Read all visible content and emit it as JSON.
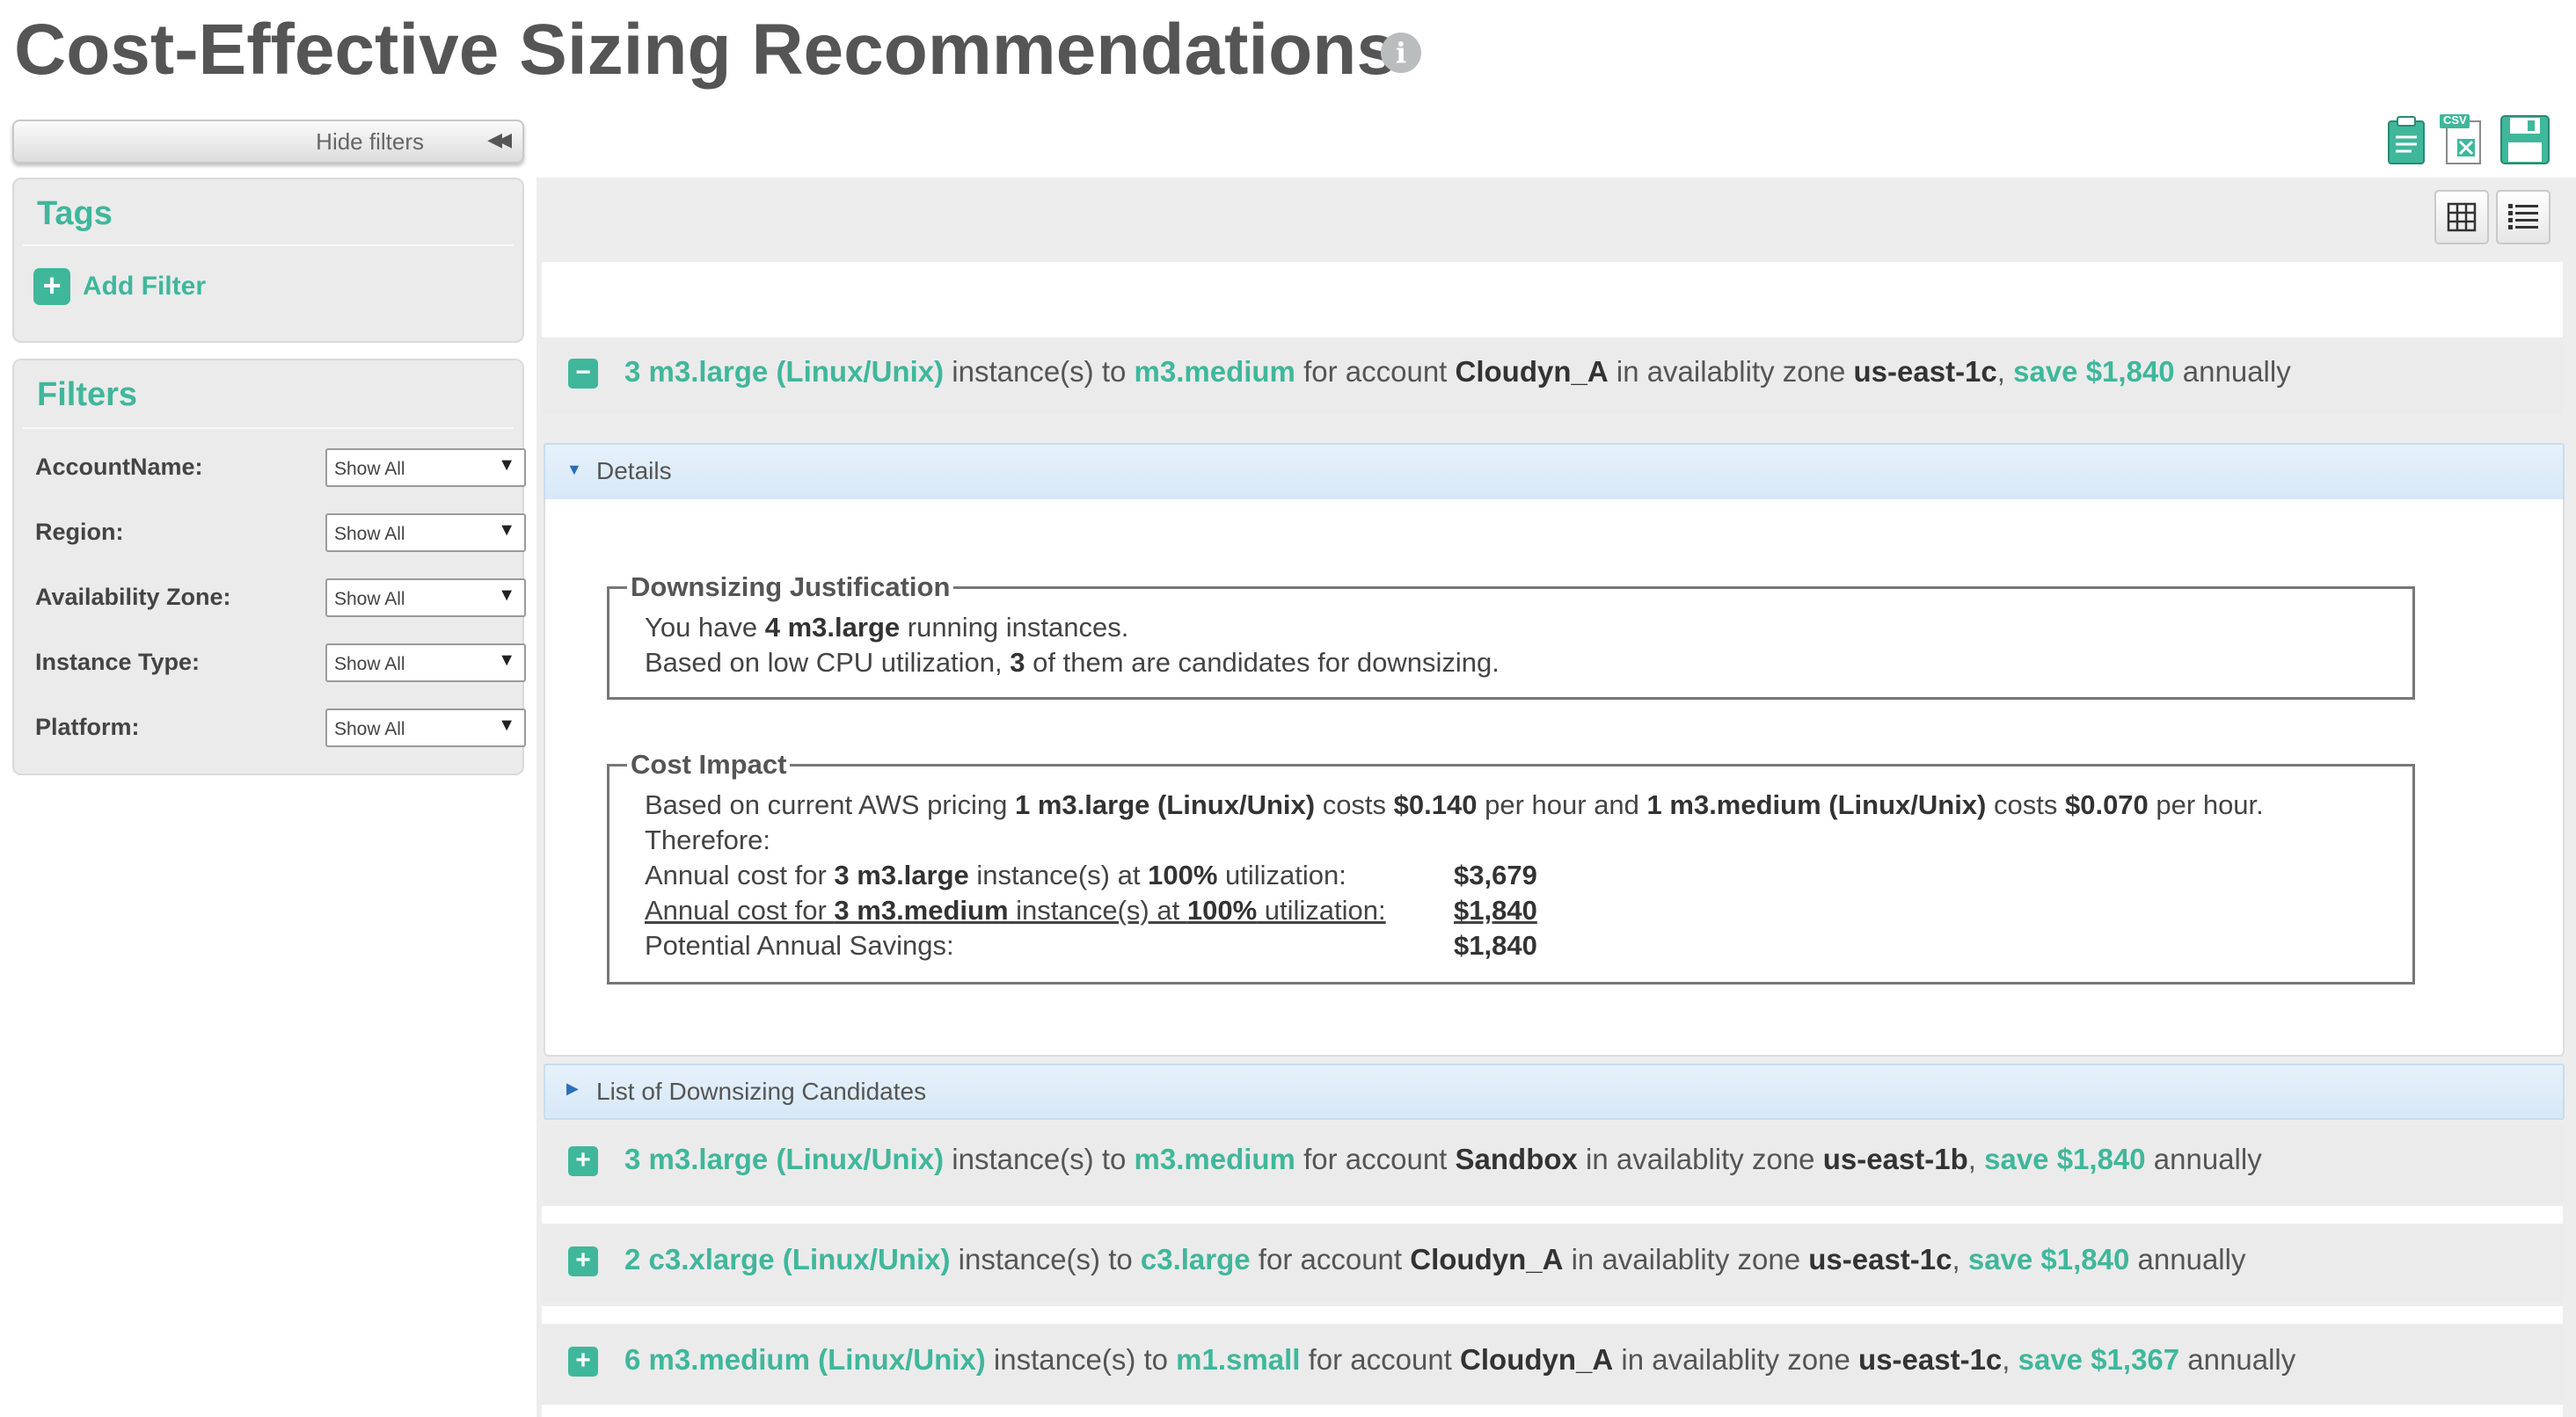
{
  "header": {
    "title": "Cost-Effective Sizing Recommendations",
    "info_glyph": "i"
  },
  "sidebar": {
    "hide_filters_label": "Hide filters",
    "hide_filters_arrow": "◀◀",
    "tags": {
      "title": "Tags",
      "add_filter_label": "Add Filter"
    },
    "filters": {
      "title": "Filters",
      "items": [
        {
          "label": "AccountName:",
          "value": "Show All"
        },
        {
          "label": "Region:",
          "value": "Show All"
        },
        {
          "label": "Availability Zone:",
          "value": "Show All"
        },
        {
          "label": "Instance Type:",
          "value": "Show All"
        },
        {
          "label": "Platform:",
          "value": "Show All"
        }
      ]
    }
  },
  "toolbar": {
    "export_icons": [
      "clipboard-icon",
      "csv-export-icon",
      "save-icon"
    ],
    "csv_badge": "CSV",
    "view_icons": [
      "grid-view-icon",
      "list-view-icon"
    ]
  },
  "recommendations": [
    {
      "toggle": "−",
      "expanded": true,
      "count": "3",
      "from_type": "m3.large (Linux/Unix)",
      "mid1": " instance(s) to ",
      "to_type": "m3.medium",
      "mid2": " for account ",
      "account": "Cloudyn_A",
      "mid3": " in availablity zone ",
      "zone": "us-east-1c",
      "sep": ", ",
      "save": "save $1,840",
      "tail": " annually"
    },
    {
      "toggle": "+",
      "expanded": false,
      "count": "3",
      "from_type": "m3.large (Linux/Unix)",
      "mid1": " instance(s) to ",
      "to_type": "m3.medium",
      "mid2": " for account ",
      "account": "Sandbox",
      "mid3": " in availablity zone ",
      "zone": "us-east-1b",
      "sep": ", ",
      "save": "save $1,840",
      "tail": " annually"
    },
    {
      "toggle": "+",
      "expanded": false,
      "count": "2",
      "from_type": "c3.xlarge (Linux/Unix)",
      "mid1": " instance(s) to ",
      "to_type": "c3.large",
      "mid2": " for account ",
      "account": "Cloudyn_A",
      "mid3": " in availablity zone ",
      "zone": "us-east-1c",
      "sep": ", ",
      "save": "save $1,840",
      "tail": " annually"
    },
    {
      "toggle": "+",
      "expanded": false,
      "count": "6",
      "from_type": "m3.medium (Linux/Unix)",
      "mid1": " instance(s) to ",
      "to_type": "m1.small",
      "mid2": " for account ",
      "account": "Cloudyn_A",
      "mid3": " in availablity zone ",
      "zone": "us-east-1c",
      "sep": ", ",
      "save": "save $1,367",
      "tail": " annually"
    }
  ],
  "details": {
    "header": "Details",
    "justification": {
      "legend": "Downsizing Justification",
      "l1_a": "You have ",
      "l1_b": "4 m3.large",
      "l1_c": " running instances.",
      "l2_a": "Based on low CPU utilization, ",
      "l2_b": "3",
      "l2_c": " of them are candidates for downsizing."
    },
    "cost_impact": {
      "legend": "Cost Impact",
      "p_a": "Based on current AWS pricing ",
      "p_b": "1 m3.large (Linux/Unix)",
      "p_c": " costs ",
      "p_d": "$0.140",
      "p_e": " per hour and ",
      "p_f": "1 m3.medium (Linux/Unix)",
      "p_g": " costs ",
      "p_h": "$0.070",
      "p_i": " per hour.",
      "therefore": "Therefore:",
      "r1_a": "Annual cost for ",
      "r1_b": "3 m3.large",
      "r1_c": " instance(s) at ",
      "r1_d": "100%",
      "r1_e": " utilization:",
      "r1_v": "$3,679",
      "r2_a": "Annual cost for ",
      "r2_b": "3 m3.medium",
      "r2_c": " instance(s) at ",
      "r2_d": "100%",
      "r2_e": " utilization:",
      "r2_v": "$1,840",
      "r3_label": "Potential Annual Savings:",
      "r3_v": "$1,840"
    }
  },
  "candidates": {
    "header": "List of Downsizing Candidates"
  },
  "colors": {
    "accent": "#3fb79b",
    "title": "#555555",
    "panel_bg": "#ebebeb",
    "accordion_bg": "#dbe9f7"
  }
}
